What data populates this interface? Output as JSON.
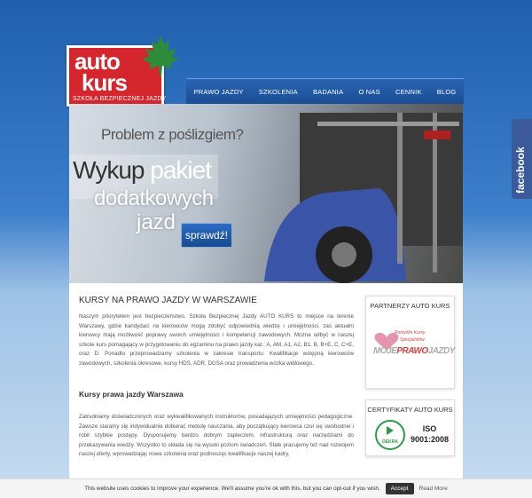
{
  "logo": {
    "line1": "auto",
    "line2": "kurs",
    "tagline": "SZKOŁA BEZPIECZNEJ JAZDY"
  },
  "nav": {
    "items": [
      "PRAWO JAZDY",
      "SZKOLENIA",
      "BADANIA",
      "O NAS",
      "CENNIK",
      "BLOG"
    ]
  },
  "hero": {
    "line1": "Problem z poślizgiem?",
    "line2a": "Wykup",
    "line2b": "pakiet",
    "line3": "dodatkowych",
    "line4": "jazd",
    "button": "sprawdź!"
  },
  "content": {
    "title": "KURSY NA PRAWO JAZDY W WARSZAWIE",
    "para1": "Naszym priorytetem jest bezpieczeństwo. Szkoła Bezpiecznej Jazdy AUTO KURS to miejsce na terenie Warszawy, gdzie kandydaci na kierowców mogą zdobyć odpowiednią wiedzę i umiejętności, zaś aktualni kierowcy mają możliwość poprawy swoich umiejętności i kompetencji zawodowych. Można odbyć w naszej szkole kurs pomagający w przygotowaniu do egzaminu na prawo jazdy kat.: A, AM, A1, A2, B1, B, B+E, C, C+E, oraz D. Ponadto przeprowadzamy szkolenia w zakresie transportu: Kwalifikacje wstępną kierowców zawodowych, szkolenia okresowe, kursy HDS, ADR, DGSA oraz prowadzenia wózka widłowego.",
    "subtitle": "Kursy prawa jazdy Warszawa",
    "para2": "Zatrudniamy doświadczonych oraz wykwalifikowanych instruktorów, posiadających umiejętności pedagogiczne. Zawsze staramy się indywidualnie dobierać metodę nauczania, aby początkujący kierowca czuł się swobodnie i robił szybkie postępy. Dysponujemy bardzo dobrym zapleczem, infrastrukturą oraz narzędziami do przekazywania wiedzy. Wszystko to składa się na wysoki poziom świadczeń. Stale pracujemy też nad rozwojem naszej oferty, wprowadzając nowe szkolenia oraz podnosząc kwalifikacje naszej kadry."
  },
  "sidebar": {
    "partners_title": "PARTNERZY AUTO KURS",
    "partner_line1": "Pomyślni Kursy",
    "partner_line2": "Specjalistów",
    "partner_line3a": "MOJE",
    "partner_line3b": "PRAWO",
    "partner_line3c": "JAZDY",
    "certs_title": "CERTYFIKATY AUTO KURS",
    "dekra": "DEKRA",
    "iso_line1": "ISO",
    "iso_line2": "9001:2008"
  },
  "facebook": {
    "label": "facebook"
  },
  "cookie": {
    "text": "This website uses cookies to improve your experience. We'll assume you're ok with this, but you can opt-out if you wish.",
    "accept": "Accept",
    "read_more": "Read More"
  },
  "colors": {
    "brand_red": "#d4262c",
    "nav_blue": "#1a4e96",
    "facebook_blue": "#3a5a99"
  }
}
